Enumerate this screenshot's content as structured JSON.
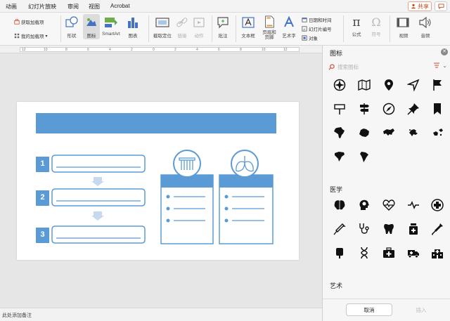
{
  "menubar": {
    "items": [
      "动画",
      "幻灯片放映",
      "审阅",
      "视图",
      "Acrobat"
    ],
    "share_label": "共享"
  },
  "ribbon": {
    "get_addins": "获取加载项",
    "my_addins": "我的加载项",
    "shapes": "形状",
    "icons": "图标",
    "smartart": "SmartArt",
    "chart": "图表",
    "screenshot": "截取定位",
    "link": "链接",
    "action": "动作",
    "comment": "批注",
    "textbox": "文本框",
    "header_footer": "页眉和\n页脚",
    "wordart": "艺术字",
    "datetime": "日期和时间",
    "slide_number": "幻灯片编号",
    "object": "对象",
    "equation": "公式",
    "symbol": "符号",
    "video": "视频",
    "audio": "音频"
  },
  "ruler": {
    "numbers": [
      "12",
      "10",
      "8",
      "6",
      "4",
      "2",
      "0",
      "2",
      "4",
      "6",
      "8",
      "10",
      "12"
    ]
  },
  "slide": {
    "steps": [
      "1",
      "2",
      "3"
    ]
  },
  "status": {
    "notes_placeholder": "此处添加备注"
  },
  "panel": {
    "title": "图标",
    "search_placeholder": "搜索图标",
    "section_medical": "医学",
    "section_art": "艺术",
    "cancel": "取消",
    "insert": "插入"
  },
  "colors": {
    "accent": "#5b9bd5",
    "brand_red": "#c24a1f"
  }
}
